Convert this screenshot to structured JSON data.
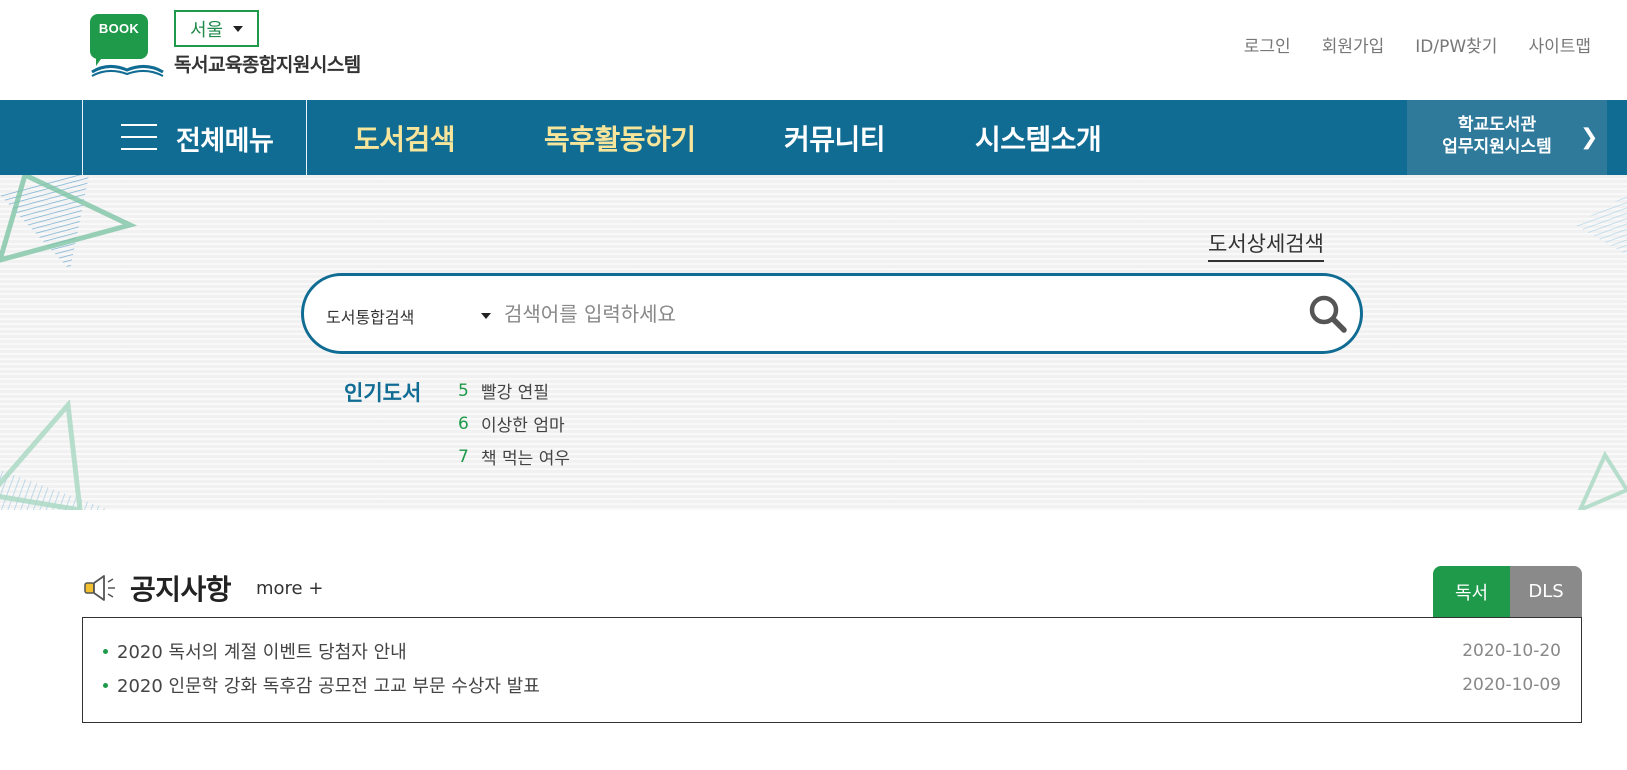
{
  "header": {
    "logo_text": "BOOK",
    "region": "서울",
    "site_title": "독서교육종합지원시스템",
    "util_links": [
      "로그인",
      "회원가입",
      "ID/PW찾기",
      "사이트맵"
    ]
  },
  "nav": {
    "all_menu": "전체메뉴",
    "items": [
      "도서검색",
      "독후활동하기",
      "커뮤니티",
      "시스템소개"
    ],
    "school_btn_line1": "학교도서관",
    "school_btn_line2": "업무지원시스템"
  },
  "search": {
    "detail_link": "도서상세검색",
    "select_value": "도서통합검색",
    "placeholder": "검색어를 입력하세요",
    "popular_heading": "인기도서",
    "popular": [
      {
        "rank": "5",
        "title": "빨강 연필"
      },
      {
        "rank": "6",
        "title": "이상한 엄마"
      },
      {
        "rank": "7",
        "title": "책 먹는 여우"
      }
    ]
  },
  "notice": {
    "title": "공지사항",
    "more": "more +",
    "tabs": [
      "독서",
      "DLS"
    ],
    "items": [
      {
        "title": "2020 독서의 계절 이벤트 당첨자 안내",
        "date": "2020-10-20"
      },
      {
        "title": "2020 인문학 강화 독후감 공모전 고교 부문 수상자 발표",
        "date": "2020-10-09"
      }
    ]
  },
  "colors": {
    "nav_bg": "#116c94",
    "nav_highlight": "#f6e59a",
    "brand_green": "#1f9a4a",
    "tab_gray": "#8a8a8a"
  },
  "icons": [
    "book-logo-icon",
    "hamburger-icon",
    "chevron-right-icon",
    "search-icon",
    "megaphone-icon",
    "caret-down-icon"
  ]
}
